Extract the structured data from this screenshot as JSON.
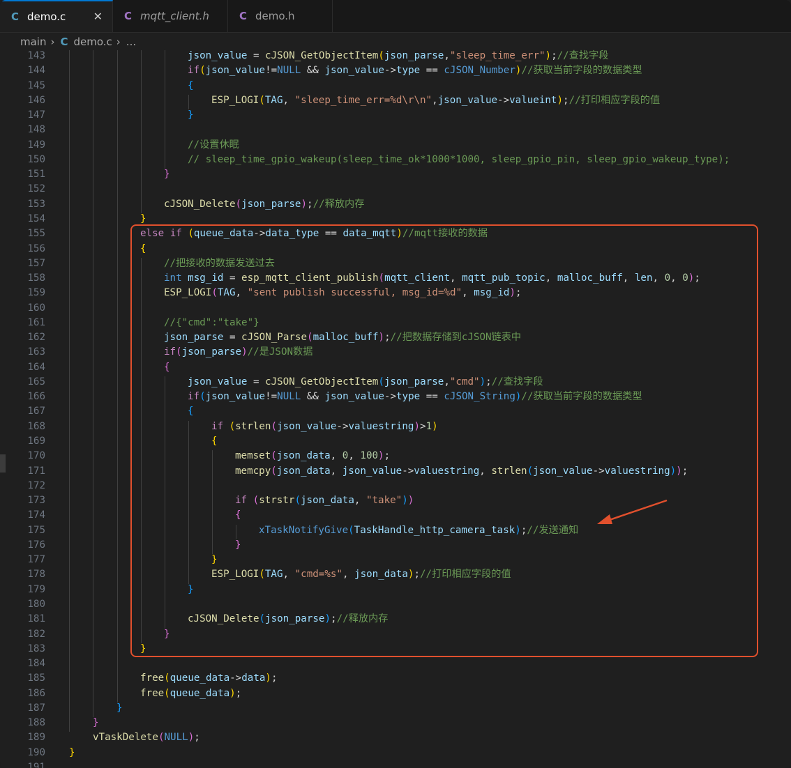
{
  "tabs": [
    {
      "label": "demo.c",
      "icon": "c-file-icon",
      "active": true
    },
    {
      "label": "mqtt_client.h",
      "icon": "c-file-icon",
      "active": false
    },
    {
      "label": "demo.h",
      "icon": "c-file-icon",
      "active": false
    }
  ],
  "tab_icon_glyph": "C",
  "close_glyph": "✕",
  "breadcrumb": {
    "folder": "main",
    "file": "demo.c",
    "rest": "..."
  },
  "lines": [
    {
      "n": "143",
      "i": 5,
      "t": [
        [
          "v",
          "json_value"
        ],
        [
          "p",
          " = "
        ],
        [
          "f",
          "cJSON_GetObjectItem"
        ],
        [
          "b1",
          "("
        ],
        [
          "v",
          "json_parse"
        ],
        [
          "p",
          ","
        ],
        [
          "s",
          "\"sleep_time_err\""
        ],
        [
          "b1",
          ")"
        ],
        [
          "p",
          ";"
        ],
        [
          "m",
          "//查找字段"
        ]
      ]
    },
    {
      "n": "144",
      "i": 5,
      "t": [
        [
          "c",
          "if"
        ],
        [
          "b1",
          "("
        ],
        [
          "v",
          "json_value"
        ],
        [
          "p",
          "!="
        ],
        [
          "cn",
          "NULL"
        ],
        [
          "p",
          " && "
        ],
        [
          "v",
          "json_value"
        ],
        [
          "p",
          "->"
        ],
        [
          "v",
          "type"
        ],
        [
          "p",
          " == "
        ],
        [
          "cn",
          "cJSON_Number"
        ],
        [
          "b1",
          ")"
        ],
        [
          "m",
          "//获取当前字段的数据类型"
        ]
      ]
    },
    {
      "n": "145",
      "i": 5,
      "t": [
        [
          "b3",
          "{"
        ]
      ]
    },
    {
      "n": "146",
      "i": 6,
      "t": [
        [
          "f",
          "ESP_LOGI"
        ],
        [
          "b1",
          "("
        ],
        [
          "v",
          "TAG"
        ],
        [
          "p",
          ", "
        ],
        [
          "s",
          "\"sleep_time_err=%d\\r\\n\""
        ],
        [
          "p",
          ","
        ],
        [
          "v",
          "json_value"
        ],
        [
          "p",
          "->"
        ],
        [
          "v",
          "valueint"
        ],
        [
          "b1",
          ")"
        ],
        [
          "p",
          ";"
        ],
        [
          "m",
          "//打印相应字段的值"
        ]
      ]
    },
    {
      "n": "147",
      "i": 5,
      "t": [
        [
          "b3",
          "}"
        ]
      ]
    },
    {
      "n": "148",
      "i": 0,
      "t": []
    },
    {
      "n": "149",
      "i": 5,
      "t": [
        [
          "m",
          "//设置休眠"
        ]
      ]
    },
    {
      "n": "150",
      "i": 5,
      "t": [
        [
          "m",
          "// sleep_time_gpio_wakeup(sleep_time_ok*1000*1000, sleep_gpio_pin, sleep_gpio_wakeup_type);"
        ]
      ]
    },
    {
      "n": "151",
      "i": 4,
      "t": [
        [
          "b2",
          "}"
        ]
      ]
    },
    {
      "n": "152",
      "i": 0,
      "t": []
    },
    {
      "n": "153",
      "i": 4,
      "t": [
        [
          "f",
          "cJSON_Delete"
        ],
        [
          "b2",
          "("
        ],
        [
          "v",
          "json_parse"
        ],
        [
          "b2",
          ")"
        ],
        [
          "p",
          ";"
        ],
        [
          "m",
          "//释放内存"
        ]
      ]
    },
    {
      "n": "154",
      "i": 3,
      "t": [
        [
          "b1",
          "}"
        ]
      ]
    },
    {
      "n": "155",
      "i": 3,
      "t": [
        [
          "c",
          "else if"
        ],
        [
          "p",
          " "
        ],
        [
          "b1",
          "("
        ],
        [
          "v",
          "queue_data"
        ],
        [
          "p",
          "->"
        ],
        [
          "v",
          "data_type"
        ],
        [
          "p",
          " == "
        ],
        [
          "v",
          "data_mqtt"
        ],
        [
          "b1",
          ")"
        ],
        [
          "m",
          "//mqtt接收的数据"
        ]
      ]
    },
    {
      "n": "156",
      "i": 3,
      "t": [
        [
          "b1",
          "{"
        ]
      ]
    },
    {
      "n": "157",
      "i": 4,
      "t": [
        [
          "m",
          "//把接收的数据发送过去"
        ]
      ]
    },
    {
      "n": "158",
      "i": 4,
      "t": [
        [
          "k",
          "int"
        ],
        [
          "p",
          " "
        ],
        [
          "v",
          "msg_id"
        ],
        [
          "p",
          " = "
        ],
        [
          "f",
          "esp_mqtt_client_publish"
        ],
        [
          "b2",
          "("
        ],
        [
          "v",
          "mqtt_client"
        ],
        [
          "p",
          ", "
        ],
        [
          "v",
          "mqtt_pub_topic"
        ],
        [
          "p",
          ", "
        ],
        [
          "v",
          "malloc_buff"
        ],
        [
          "p",
          ", "
        ],
        [
          "v",
          "len"
        ],
        [
          "p",
          ", "
        ],
        [
          "n",
          "0"
        ],
        [
          "p",
          ", "
        ],
        [
          "n",
          "0"
        ],
        [
          "b2",
          ")"
        ],
        [
          "p",
          ";"
        ]
      ]
    },
    {
      "n": "159",
      "i": 4,
      "t": [
        [
          "f",
          "ESP_LOGI"
        ],
        [
          "b2",
          "("
        ],
        [
          "v",
          "TAG"
        ],
        [
          "p",
          ", "
        ],
        [
          "s",
          "\"sent publish successful, msg_id=%d\""
        ],
        [
          "p",
          ", "
        ],
        [
          "v",
          "msg_id"
        ],
        [
          "b2",
          ")"
        ],
        [
          "p",
          ";"
        ]
      ]
    },
    {
      "n": "160",
      "i": 0,
      "t": []
    },
    {
      "n": "161",
      "i": 4,
      "t": [
        [
          "m",
          "//{\"cmd\":\"take\"}"
        ]
      ]
    },
    {
      "n": "162",
      "i": 4,
      "t": [
        [
          "v",
          "json_parse"
        ],
        [
          "p",
          " = "
        ],
        [
          "f",
          "cJSON_Parse"
        ],
        [
          "b2",
          "("
        ],
        [
          "v",
          "malloc_buff"
        ],
        [
          "b2",
          ")"
        ],
        [
          "p",
          ";"
        ],
        [
          "m",
          "//把数据存储到cJSON链表中"
        ]
      ]
    },
    {
      "n": "163",
      "i": 4,
      "t": [
        [
          "c",
          "if"
        ],
        [
          "b2",
          "("
        ],
        [
          "v",
          "json_parse"
        ],
        [
          "b2",
          ")"
        ],
        [
          "m",
          "//是JSON数据"
        ]
      ]
    },
    {
      "n": "164",
      "i": 4,
      "t": [
        [
          "b2",
          "{"
        ]
      ]
    },
    {
      "n": "165",
      "i": 5,
      "t": [
        [
          "v",
          "json_value"
        ],
        [
          "p",
          " = "
        ],
        [
          "f",
          "cJSON_GetObjectItem"
        ],
        [
          "b3",
          "("
        ],
        [
          "v",
          "json_parse"
        ],
        [
          "p",
          ","
        ],
        [
          "s",
          "\"cmd\""
        ],
        [
          "b3",
          ")"
        ],
        [
          "p",
          ";"
        ],
        [
          "m",
          "//查找字段"
        ]
      ]
    },
    {
      "n": "166",
      "i": 5,
      "t": [
        [
          "c",
          "if"
        ],
        [
          "b3",
          "("
        ],
        [
          "v",
          "json_value"
        ],
        [
          "p",
          "!="
        ],
        [
          "cn",
          "NULL"
        ],
        [
          "p",
          " && "
        ],
        [
          "v",
          "json_value"
        ],
        [
          "p",
          "->"
        ],
        [
          "v",
          "type"
        ],
        [
          "p",
          " == "
        ],
        [
          "cn",
          "cJSON_String"
        ],
        [
          "b3",
          ")"
        ],
        [
          "m",
          "//获取当前字段的数据类型"
        ]
      ]
    },
    {
      "n": "167",
      "i": 5,
      "t": [
        [
          "b3",
          "{"
        ]
      ]
    },
    {
      "n": "168",
      "i": 6,
      "t": [
        [
          "c",
          "if"
        ],
        [
          "p",
          " "
        ],
        [
          "b1",
          "("
        ],
        [
          "f",
          "strlen"
        ],
        [
          "b2",
          "("
        ],
        [
          "v",
          "json_value"
        ],
        [
          "p",
          "->"
        ],
        [
          "v",
          "valuestring"
        ],
        [
          "b2",
          ")"
        ],
        [
          "p",
          ">"
        ],
        [
          "n",
          "1"
        ],
        [
          "b1",
          ")"
        ]
      ]
    },
    {
      "n": "169",
      "i": 6,
      "t": [
        [
          "b1",
          "{"
        ]
      ]
    },
    {
      "n": "170",
      "i": 7,
      "t": [
        [
          "f",
          "memset"
        ],
        [
          "b2",
          "("
        ],
        [
          "v",
          "json_data"
        ],
        [
          "p",
          ", "
        ],
        [
          "n",
          "0"
        ],
        [
          "p",
          ", "
        ],
        [
          "n",
          "100"
        ],
        [
          "b2",
          ")"
        ],
        [
          "p",
          ";"
        ]
      ]
    },
    {
      "n": "171",
      "i": 7,
      "t": [
        [
          "f",
          "memcpy"
        ],
        [
          "b2",
          "("
        ],
        [
          "v",
          "json_data"
        ],
        [
          "p",
          ", "
        ],
        [
          "v",
          "json_value"
        ],
        [
          "p",
          "->"
        ],
        [
          "v",
          "valuestring"
        ],
        [
          "p",
          ", "
        ],
        [
          "f",
          "strlen"
        ],
        [
          "b3",
          "("
        ],
        [
          "v",
          "json_value"
        ],
        [
          "p",
          "->"
        ],
        [
          "v",
          "valuestring"
        ],
        [
          "b3",
          ")"
        ],
        [
          "b2",
          ")"
        ],
        [
          "p",
          ";"
        ]
      ]
    },
    {
      "n": "172",
      "i": 0,
      "t": []
    },
    {
      "n": "173",
      "i": 7,
      "t": [
        [
          "c",
          "if"
        ],
        [
          "p",
          " "
        ],
        [
          "b2",
          "("
        ],
        [
          "f",
          "strstr"
        ],
        [
          "b3",
          "("
        ],
        [
          "v",
          "json_data"
        ],
        [
          "p",
          ", "
        ],
        [
          "s",
          "\"take\""
        ],
        [
          "b3",
          ")"
        ],
        [
          "b2",
          ")"
        ]
      ]
    },
    {
      "n": "174",
      "i": 7,
      "t": [
        [
          "b2",
          "{"
        ]
      ]
    },
    {
      "n": "175",
      "i": 8,
      "t": [
        [
          "k",
          "xTaskNotifyGive"
        ],
        [
          "b3",
          "("
        ],
        [
          "v",
          "TaskHandle_http_camera_task"
        ],
        [
          "b3",
          ")"
        ],
        [
          "p",
          ";"
        ],
        [
          "m",
          "//发送通知"
        ]
      ]
    },
    {
      "n": "176",
      "i": 7,
      "t": [
        [
          "b2",
          "}"
        ]
      ]
    },
    {
      "n": "177",
      "i": 6,
      "t": [
        [
          "b1",
          "}"
        ]
      ]
    },
    {
      "n": "178",
      "i": 6,
      "t": [
        [
          "f",
          "ESP_LOGI"
        ],
        [
          "b1",
          "("
        ],
        [
          "v",
          "TAG"
        ],
        [
          "p",
          ", "
        ],
        [
          "s",
          "\"cmd=%s\""
        ],
        [
          "p",
          ", "
        ],
        [
          "v",
          "json_data"
        ],
        [
          "b1",
          ")"
        ],
        [
          "p",
          ";"
        ],
        [
          "m",
          "//打印相应字段的值"
        ]
      ]
    },
    {
      "n": "179",
      "i": 5,
      "t": [
        [
          "b3",
          "}"
        ]
      ]
    },
    {
      "n": "180",
      "i": 0,
      "t": []
    },
    {
      "n": "181",
      "i": 5,
      "t": [
        [
          "f",
          "cJSON_Delete"
        ],
        [
          "b3",
          "("
        ],
        [
          "v",
          "json_parse"
        ],
        [
          "b3",
          ")"
        ],
        [
          "p",
          ";"
        ],
        [
          "m",
          "//释放内存"
        ]
      ]
    },
    {
      "n": "182",
      "i": 4,
      "t": [
        [
          "b2",
          "}"
        ]
      ]
    },
    {
      "n": "183",
      "i": 3,
      "t": [
        [
          "b1",
          "}"
        ]
      ]
    },
    {
      "n": "184",
      "i": 0,
      "t": []
    },
    {
      "n": "185",
      "i": 3,
      "t": [
        [
          "f",
          "free"
        ],
        [
          "b1",
          "("
        ],
        [
          "v",
          "queue_data"
        ],
        [
          "p",
          "->"
        ],
        [
          "v",
          "data"
        ],
        [
          "b1",
          ")"
        ],
        [
          "p",
          ";"
        ]
      ]
    },
    {
      "n": "186",
      "i": 3,
      "t": [
        [
          "f",
          "free"
        ],
        [
          "b1",
          "("
        ],
        [
          "v",
          "queue_data"
        ],
        [
          "b1",
          ")"
        ],
        [
          "p",
          ";"
        ]
      ]
    },
    {
      "n": "187",
      "i": 2,
      "t": [
        [
          "b3",
          "}"
        ]
      ]
    },
    {
      "n": "188",
      "i": 1,
      "t": [
        [
          "b2",
          "}"
        ]
      ]
    },
    {
      "n": "189",
      "i": 1,
      "t": [
        [
          "f",
          "vTaskDelete"
        ],
        [
          "b2",
          "("
        ],
        [
          "cn",
          "NULL"
        ],
        [
          "b2",
          ")"
        ],
        [
          "p",
          ";"
        ]
      ]
    },
    {
      "n": "190",
      "i": 0,
      "t": [
        [
          "b1",
          "}"
        ]
      ]
    },
    {
      "n": "191",
      "i": 0,
      "t": []
    }
  ],
  "colors": {
    "accent": "#0078d4",
    "highlight_box": "#e1502d",
    "arrow": "#e1502d"
  }
}
